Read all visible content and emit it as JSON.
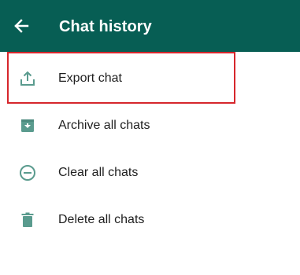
{
  "app_bar": {
    "title": "Chat history",
    "background_color": "#075e54",
    "back_icon": "arrow-left-icon"
  },
  "menu": {
    "icon_color": "#5a9b8e",
    "items": [
      {
        "label": "Export chat",
        "icon": "upload-icon",
        "highlighted": true
      },
      {
        "label": "Archive all chats",
        "icon": "archive-icon",
        "highlighted": false
      },
      {
        "label": "Clear all chats",
        "icon": "minus-circle-icon",
        "highlighted": false
      },
      {
        "label": "Delete all chats",
        "icon": "trash-icon",
        "highlighted": false
      }
    ]
  },
  "highlight_color": "#d6262c"
}
